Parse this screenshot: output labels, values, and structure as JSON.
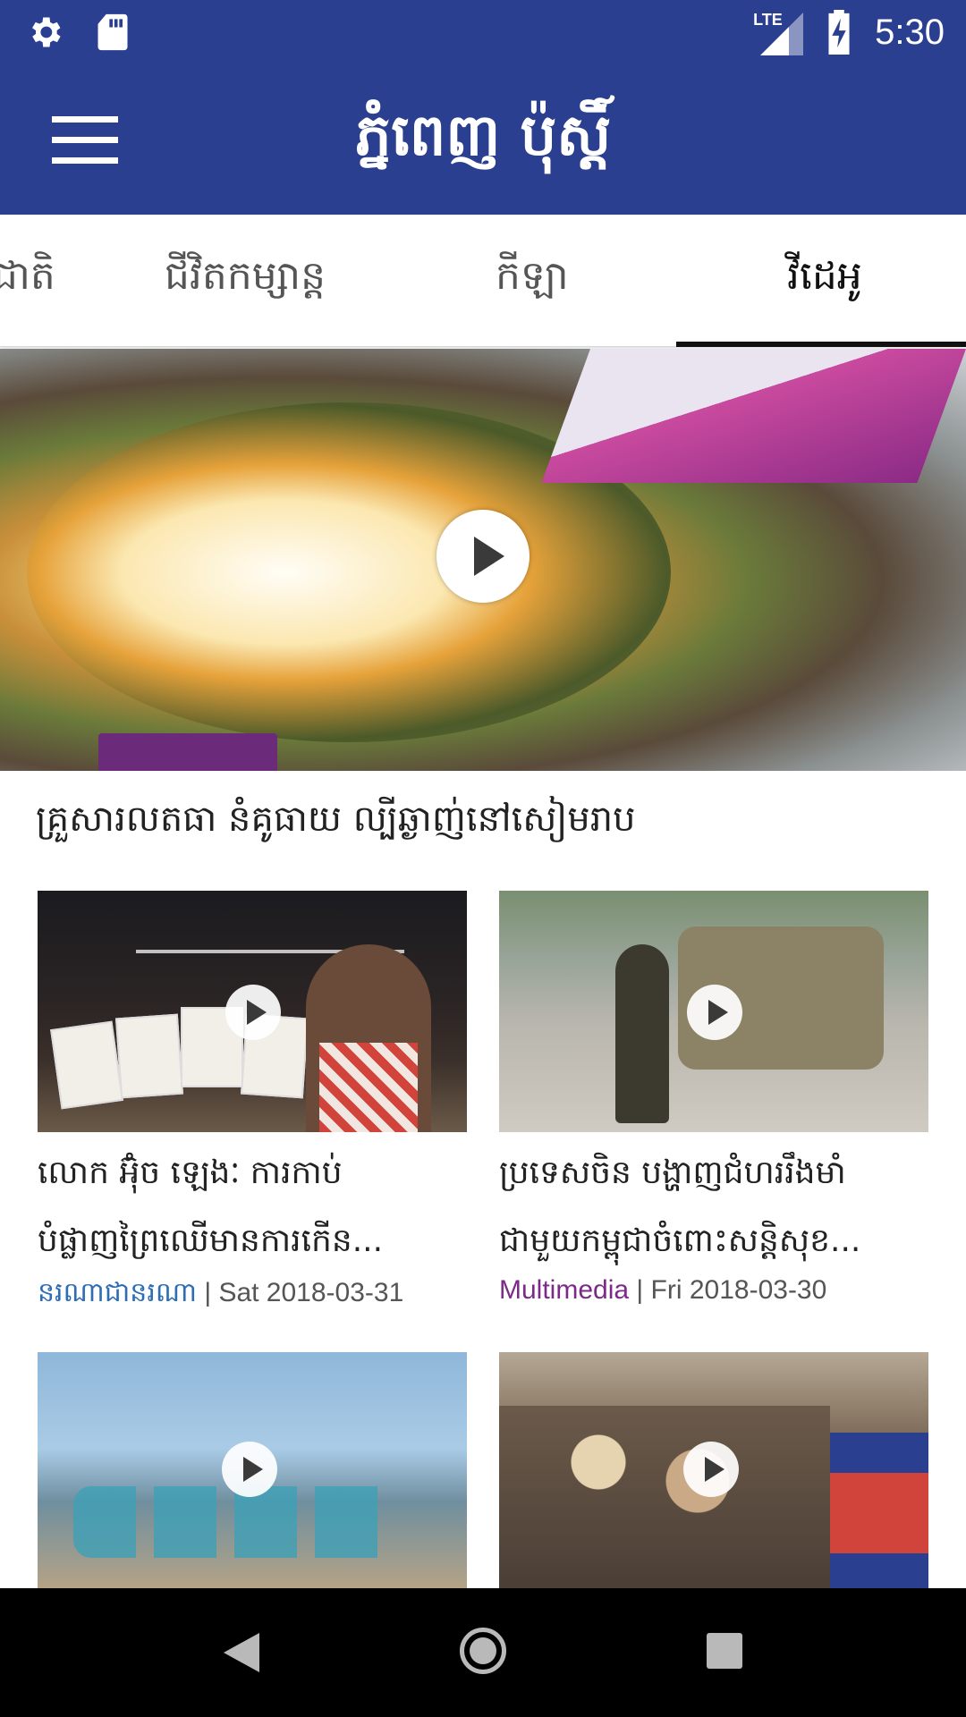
{
  "status_bar": {
    "time": "5:30",
    "network_label": "LTE",
    "icons": [
      "gear-icon",
      "sd-card-icon",
      "lte-signal-icon",
      "battery-charging-icon"
    ]
  },
  "app_bar": {
    "title": "ភ្នំពេញ ប៉ុស្ដិ៍",
    "menu_icon": "hamburger-menu-icon"
  },
  "tabs": [
    {
      "label": "ជាតិ",
      "active": false
    },
    {
      "label": "ជីវិតកម្សាន្ត",
      "active": false
    },
    {
      "label": "កីឡា",
      "active": false
    },
    {
      "label": "វីដេអូ",
      "active": true
    }
  ],
  "hero": {
    "caption": "គ្រួសារលតធា នំគូធាយ ល្បីឆ្ងាញ់នៅសៀមរាប",
    "icon": "play-icon"
  },
  "cards": [
    {
      "title_line1": "លោក អ៊ុំច ឡេងៈ ការកាប់",
      "title_line2": "បំផ្លាញព្រៃឈើមានការកើន...",
      "category": "នរណាជានរណា",
      "date": " | Sat 2018-03-31",
      "category_color": "#2e6db4"
    },
    {
      "title_line1": "ប្រទេសចិន បង្ហាញជំហររឹងមាំ",
      "title_line2": "ជាមួយកម្ពុជាចំពោះសន្តិសុខ...",
      "category": "Multimedia",
      "date": " | Fri 2018-03-30",
      "category_color": "#7b2a87"
    },
    {},
    {}
  ],
  "nav_bar": {
    "icons": [
      "back-icon",
      "home-icon",
      "recent-apps-icon"
    ]
  },
  "colors": {
    "primary": "#2a3f8f",
    "category_blue": "#2e6db4",
    "category_purple": "#7b2a87"
  }
}
